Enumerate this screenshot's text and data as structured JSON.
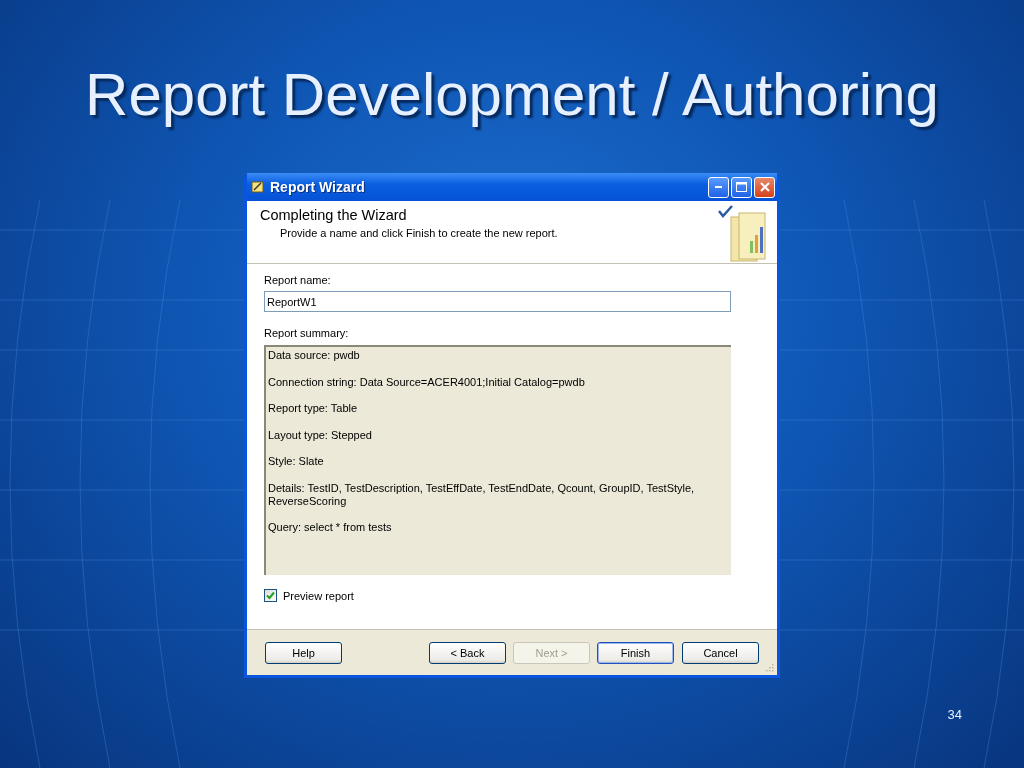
{
  "slide": {
    "title": "Report Development / Authoring",
    "page_number": "34"
  },
  "window": {
    "title": "Report Wizard"
  },
  "header": {
    "title": "Completing the Wizard",
    "subtitle": "Provide a name and click Finish to create the new report."
  },
  "report_name": {
    "label": "Report name:",
    "value": "ReportW1"
  },
  "summary": {
    "label": "Report summary:",
    "lines": [
      "Data source: pwdb",
      "Connection string: Data Source=ACER4001;Initial Catalog=pwdb",
      "Report type: Table",
      "Layout type: Stepped",
      "Style: Slate",
      "Details: TestID, TestDescription, TestEffDate, TestEndDate, Qcount, GroupID, TestStyle, ReverseScoring",
      "Query:  select * from tests"
    ]
  },
  "preview": {
    "label": "Preview report",
    "checked": true
  },
  "buttons": [
    {
      "label": "Help",
      "disabled": false,
      "default": false
    },
    {
      "label": "< Back",
      "disabled": false,
      "default": false
    },
    {
      "label": "Next >",
      "disabled": true,
      "default": false
    },
    {
      "label": "Finish",
      "disabled": false,
      "default": true
    },
    {
      "label": "Cancel",
      "disabled": false,
      "default": false
    }
  ]
}
